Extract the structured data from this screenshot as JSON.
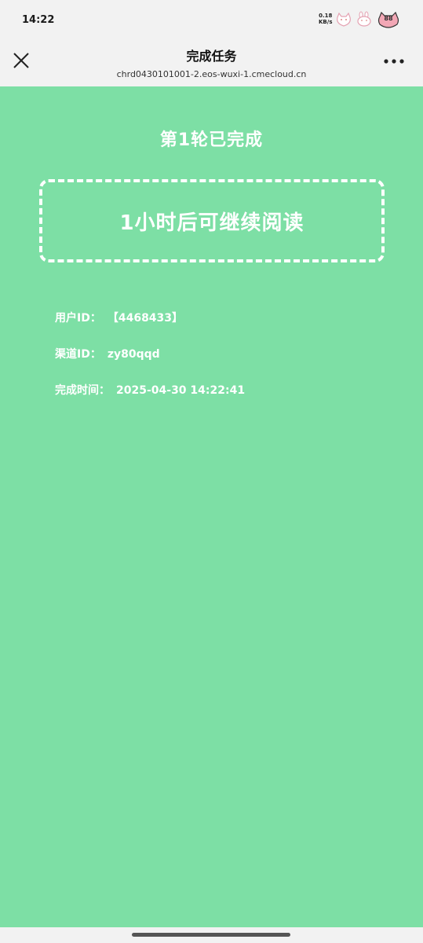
{
  "status_bar": {
    "time": "14:22",
    "net_speed_value": "0.18",
    "net_speed_unit": "KB/s",
    "battery_level": "88",
    "icons": [
      "cat-sticker-icon",
      "bunny-sticker-icon"
    ],
    "colors": {
      "battery": "#f2a7b5"
    }
  },
  "nav": {
    "title": "完成任务",
    "subtitle": "chrd0430101001-2.eos-wuxi-1.cmecloud.cn",
    "close_icon": "close-icon",
    "more_icon": "more-dots-icon"
  },
  "main": {
    "background_color": "#7ddfa5",
    "round_title": "第1轮已完成",
    "notice": "1小时后可继续阅读",
    "user_label": "用户ID：",
    "user_value": "【4468433】",
    "channel_label": "渠道ID：",
    "channel_value": "zy80qqd",
    "time_label": "完成时间：",
    "time_value": "2025-04-30 14:22:41"
  }
}
